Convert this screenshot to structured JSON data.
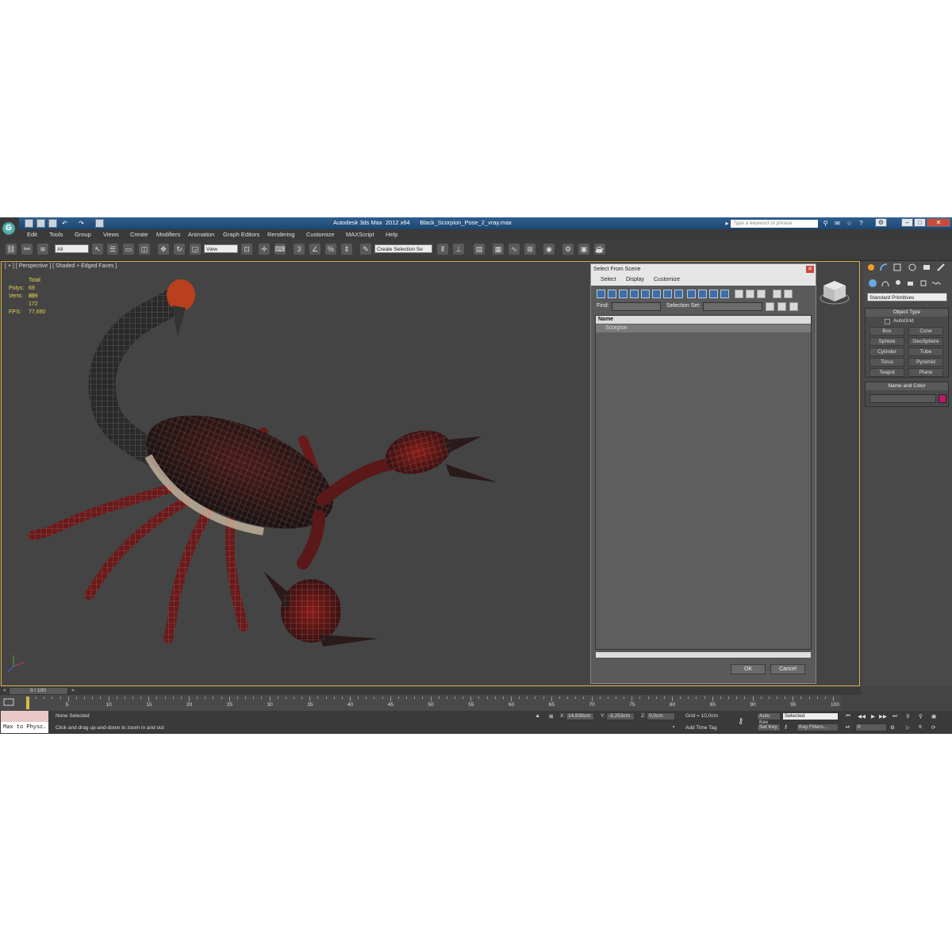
{
  "window": {
    "title": "Autodesk 3ds Max  2012 x64      Black_Scorpion_Pose_2_vray.max",
    "search_placeholder": "Type a keyword or phrase"
  },
  "menu": [
    "Edit",
    "Tools",
    "Group",
    "Views",
    "Create",
    "Modifiers",
    "Animation",
    "Graph Editors",
    "Rendering",
    "Customize",
    "MAXScript",
    "Help"
  ],
  "toolbar": {
    "selection_filter": "All",
    "ref_coord": "View",
    "named_selection": "Create Selection Se"
  },
  "viewport": {
    "label": "[ + ] [ Perspective ] [ Shaded + Edged Faces ]",
    "stats": {
      "total_label": "Total",
      "polys_label": "Polys:",
      "polys_value": "69 839",
      "verts_label": "Verts:",
      "verts_value": "80 172",
      "fps_label": "FPS:",
      "fps_value": "77,690"
    }
  },
  "dialog": {
    "title": "Select From Scene",
    "menu": [
      "Select",
      "Display",
      "Customize"
    ],
    "find_label": "Find:",
    "selection_set_label": "Selection Set:",
    "column_name": "Name",
    "items": [
      "Scorpion"
    ],
    "ok_label": "OK",
    "cancel_label": "Cancel"
  },
  "command_panel": {
    "dropdown": "Standard Primitives",
    "object_type_title": "Object Type",
    "autogrid_label": "AutoGrid",
    "primitives": [
      "Box",
      "Cone",
      "Sphere",
      "GeoSphere",
      "Cylinder",
      "Tube",
      "Torus",
      "Pyramid",
      "Teapot",
      "Plane"
    ],
    "name_color_title": "Name and Color",
    "object_color": "#c0186a"
  },
  "timeline": {
    "frame_display": "0 / 100",
    "ticks": [
      "5",
      "10",
      "15",
      "20",
      "25",
      "30",
      "35",
      "40",
      "45",
      "50",
      "55",
      "60",
      "65",
      "70",
      "75",
      "80",
      "85",
      "90",
      "95",
      "100"
    ]
  },
  "status_bar": {
    "script_text": "Max to Physc.",
    "selection_status": "None Selected",
    "prompt": "Click and drag up-and-down to zoom in and out",
    "x_label": "X:",
    "x_value": "14,838cm",
    "y_label": "Y:",
    "y_value": "-3,253cm",
    "z_label": "Z:",
    "z_value": "0,0cm",
    "grid": "Grid = 10,0cm",
    "add_time_tag": "Add Time Tag",
    "auto_key": "Auto Key",
    "set_key": "Set Key",
    "key_mode": "Selected",
    "key_filters": "Key Filters...",
    "current_frame": "0"
  }
}
